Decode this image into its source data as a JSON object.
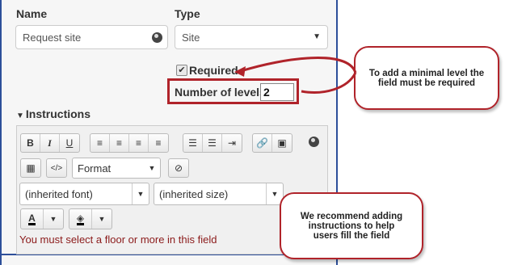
{
  "form": {
    "name_label": "Name",
    "name_value": "Request site",
    "type_label": "Type",
    "type_value": "Site",
    "required_label": "Required",
    "required_checked": true,
    "levels_label": "Number of levels",
    "levels_value": "2",
    "instructions_label": "Instructions"
  },
  "editor": {
    "format_value": "Format",
    "font_value": "(inherited font)",
    "size_value": "(inherited size)",
    "content_text": "You must select a floor or more in this field",
    "toolbar_row1": [
      [
        "bold-icon",
        "italic-icon",
        "underline-icon"
      ],
      [
        "align-left-icon",
        "align-center-icon",
        "align-right-icon",
        "align-justify-icon"
      ],
      [
        "bullet-list-icon",
        "numbered-list-icon",
        "indent-icon"
      ],
      [
        "link-icon",
        "image-icon"
      ]
    ],
    "bold_glyph": "B",
    "italic_glyph": "I",
    "underline_glyph": "U",
    "font_color_glyph": "A"
  },
  "callouts": {
    "top": "To add a minimal level the field must be required",
    "bottom": "We recommend adding instructions to help users fill the field"
  },
  "colors": {
    "accent_blue": "#2d4f9a",
    "callout_red": "#b0232a",
    "hint_text": "#8b1a1a"
  }
}
